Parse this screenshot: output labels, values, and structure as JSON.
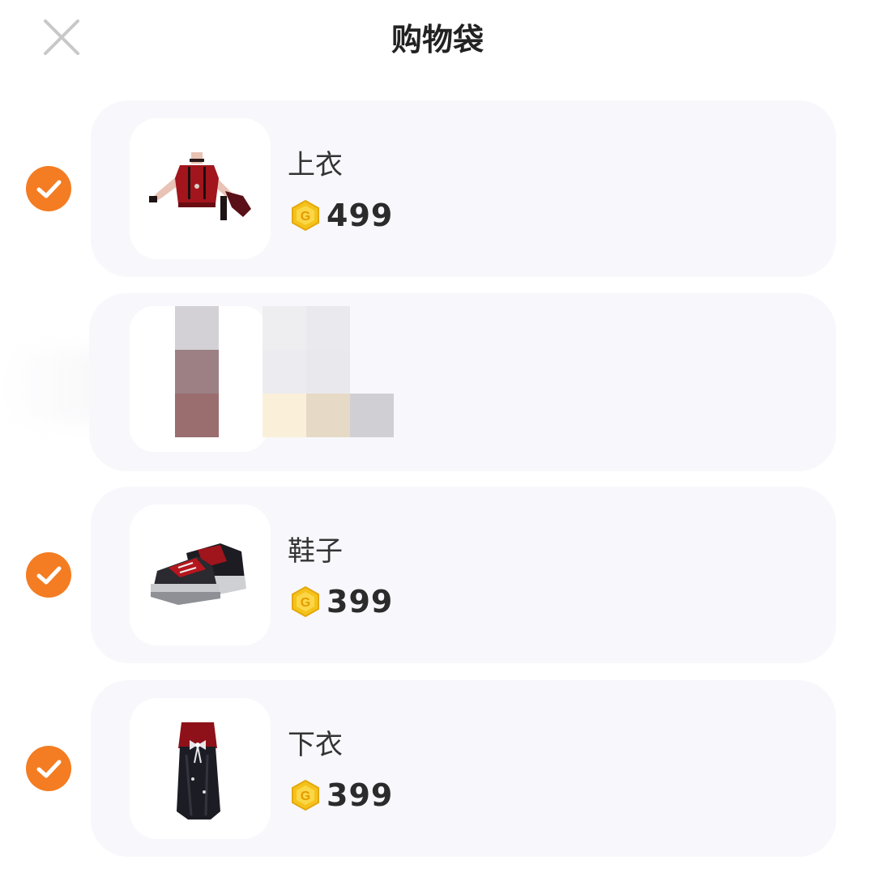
{
  "header": {
    "title": "购物袋",
    "close_icon": "close-icon"
  },
  "colors": {
    "accent": "#f47c22",
    "coin": "#f5c21b",
    "card_bg": "#f8f7fb"
  },
  "items": [
    {
      "name": "上衣",
      "price": "499",
      "selected": true,
      "thumb_icon": "top-garment-icon"
    },
    {
      "name": "",
      "price": "",
      "selected": false,
      "thumb_icon": "pixelated-item"
    },
    {
      "name": "鞋子",
      "price": "399",
      "selected": true,
      "thumb_icon": "sneakers-icon"
    },
    {
      "name": "下衣",
      "price": "399",
      "selected": true,
      "thumb_icon": "skirt-icon"
    }
  ]
}
